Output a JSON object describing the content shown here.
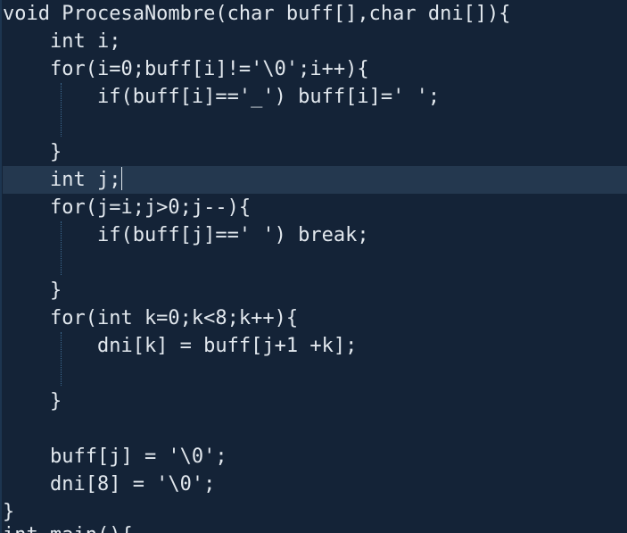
{
  "editor": {
    "colors": {
      "background": "#142337",
      "current_line": "#24384f",
      "text": "#e2e8ee",
      "indent_guide": "#3d6a90"
    },
    "lines": [
      "void ProcesaNombre(char buff[],char dni[]){",
      "    int i;",
      "    for(i=0;buff[i]!='\\0';i++){",
      "        if(buff[i]=='_') buff[i]=' ';",
      "",
      "    }",
      "    int j;",
      "    for(j=i;j>0;j--){",
      "        if(buff[j]==' ') break;",
      "",
      "    }",
      "    for(int k=0;k<8;k++){",
      "        dni[k] = buff[j+1 +k];",
      "",
      "    }",
      "",
      "    buff[j] = '\\0';",
      "    dni[8] = '\\0';",
      "}",
      "int main(){"
    ]
  }
}
